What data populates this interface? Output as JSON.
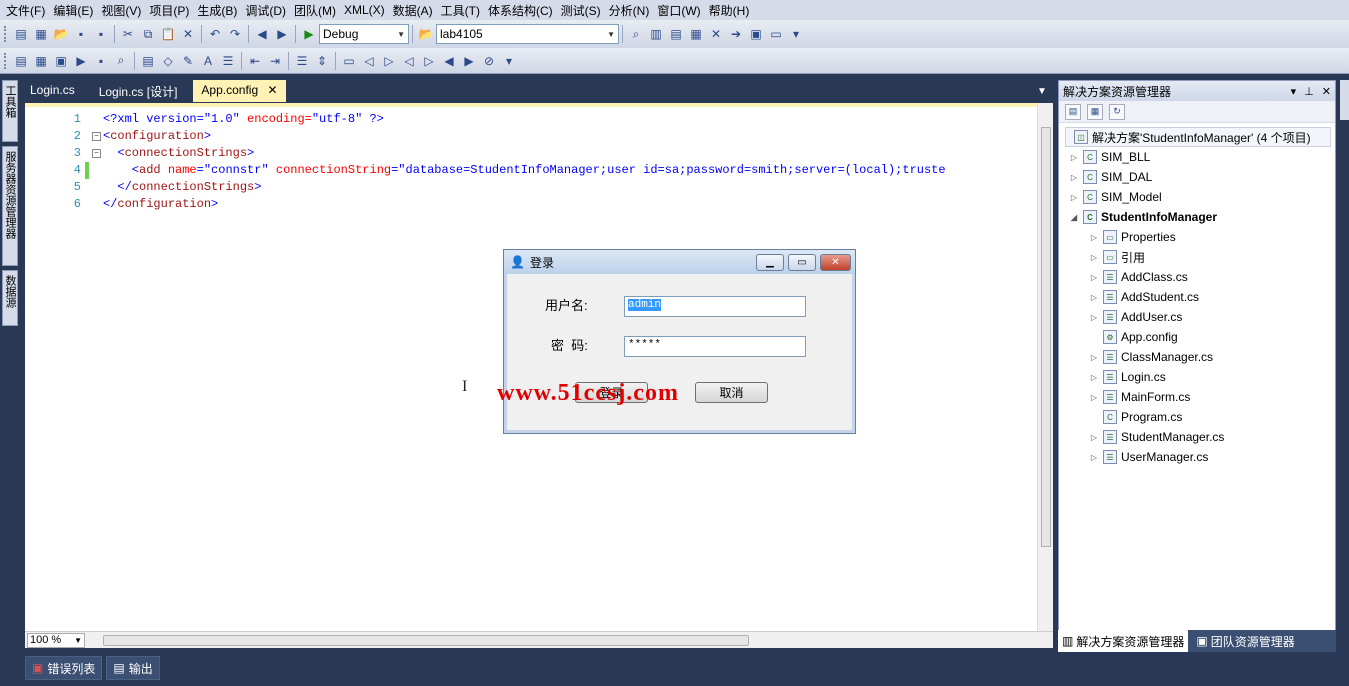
{
  "menu": [
    "文件(F)",
    "编辑(E)",
    "视图(V)",
    "项目(P)",
    "生成(B)",
    "调试(D)",
    "团队(M)",
    "XML(X)",
    "数据(A)",
    "工具(T)",
    "体系结构(C)",
    "测试(S)",
    "分析(N)",
    "窗口(W)",
    "帮助(H)"
  ],
  "toolbar": {
    "config_combo": "Debug",
    "target_combo": "lab4105"
  },
  "left_strip": [
    "工具箱",
    "服务器资源管理器",
    "数据源"
  ],
  "doc_tabs": [
    {
      "label": "Login.cs",
      "active": false
    },
    {
      "label": "Login.cs [设计]",
      "active": false
    },
    {
      "label": "App.config",
      "active": true
    }
  ],
  "code": {
    "line_numbers": [
      "1",
      "2",
      "3",
      "4",
      "5",
      "6"
    ],
    "lines": [
      [
        {
          "t": "<?xml version=",
          "c": "bl"
        },
        {
          "t": "\"1.0\"",
          "c": "bl"
        },
        {
          "t": " encoding=",
          "c": "rd"
        },
        {
          "t": "\"utf-8\"",
          "c": "bl"
        },
        {
          "t": " ?>",
          "c": "bl"
        }
      ],
      [
        {
          "t": "<",
          "c": "bl"
        },
        {
          "t": "configuration",
          "c": "mr"
        },
        {
          "t": ">",
          "c": "bl"
        }
      ],
      [
        {
          "t": "  <",
          "c": "bl"
        },
        {
          "t": "connectionStrings",
          "c": "mr"
        },
        {
          "t": ">",
          "c": "bl"
        }
      ],
      [
        {
          "t": "    <",
          "c": "bl"
        },
        {
          "t": "add",
          "c": "mr"
        },
        {
          "t": " name",
          "c": "rd"
        },
        {
          "t": "=\"",
          "c": "bl"
        },
        {
          "t": "connstr",
          "c": "bl"
        },
        {
          "t": "\"",
          "c": "bl"
        },
        {
          "t": " connectionString",
          "c": "rd"
        },
        {
          "t": "=\"",
          "c": "bl"
        },
        {
          "t": "database=StudentInfoManager;user id=sa;password=smith;server=(local);truste",
          "c": "bl"
        }
      ],
      [
        {
          "t": "  </",
          "c": "bl"
        },
        {
          "t": "connectionStrings",
          "c": "mr"
        },
        {
          "t": ">",
          "c": "bl"
        }
      ],
      [
        {
          "t": "</",
          "c": "bl"
        },
        {
          "t": "configuration",
          "c": "mr"
        },
        {
          "t": ">",
          "c": "bl"
        }
      ]
    ]
  },
  "zoom": "100 %",
  "bottom_tabs": [
    "错误列表",
    "输出"
  ],
  "login_dialog": {
    "title": "登录",
    "username_label": "用户名:",
    "username_value": "admin",
    "password_label": "密  码:",
    "password_value": "*****",
    "login_button": "登录",
    "cancel_button": "取消"
  },
  "watermark": "www.51ccsj.com",
  "solution_explorer": {
    "title": "解决方案资源管理器",
    "tree": [
      {
        "label": "解决方案'StudentInfoManager' (4 个项目)",
        "level": 0,
        "icon": "solution-icon",
        "expander": "",
        "bold": false,
        "root": true
      },
      {
        "label": "SIM_BLL",
        "level": 1,
        "icon": "csharp-project-icon",
        "expander": "▷",
        "bold": false
      },
      {
        "label": "SIM_DAL",
        "level": 1,
        "icon": "csharp-project-icon",
        "expander": "▷",
        "bold": false
      },
      {
        "label": "SIM_Model",
        "level": 1,
        "icon": "csharp-project-icon",
        "expander": "▷",
        "bold": false
      },
      {
        "label": "StudentInfoManager",
        "level": 1,
        "icon": "csharp-project-icon",
        "expander": "◢",
        "bold": true
      },
      {
        "label": "Properties",
        "level": 2,
        "icon": "properties-folder-icon",
        "expander": "▷",
        "bold": false
      },
      {
        "label": "引用",
        "level": 2,
        "icon": "references-icon",
        "expander": "▷",
        "bold": false
      },
      {
        "label": "AddClass.cs",
        "level": 2,
        "icon": "form-file-icon",
        "expander": "▷",
        "bold": false
      },
      {
        "label": "AddStudent.cs",
        "level": 2,
        "icon": "form-file-icon",
        "expander": "▷",
        "bold": false
      },
      {
        "label": "AddUser.cs",
        "level": 2,
        "icon": "form-file-icon",
        "expander": "▷",
        "bold": false
      },
      {
        "label": "App.config",
        "level": 2,
        "icon": "config-file-icon",
        "expander": "",
        "bold": false
      },
      {
        "label": "ClassManager.cs",
        "level": 2,
        "icon": "form-file-icon",
        "expander": "▷",
        "bold": false
      },
      {
        "label": "Login.cs",
        "level": 2,
        "icon": "form-file-icon",
        "expander": "▷",
        "bold": false
      },
      {
        "label": "MainForm.cs",
        "level": 2,
        "icon": "form-file-icon",
        "expander": "▷",
        "bold": false
      },
      {
        "label": "Program.cs",
        "level": 2,
        "icon": "csharp-file-icon",
        "expander": "",
        "bold": false
      },
      {
        "label": "StudentManager.cs",
        "level": 2,
        "icon": "form-file-icon",
        "expander": "▷",
        "bold": false
      },
      {
        "label": "UserManager.cs",
        "level": 2,
        "icon": "form-file-icon",
        "expander": "▷",
        "bold": false
      }
    ],
    "bottom_tabs": [
      "解决方案资源管理器",
      "团队资源管理器"
    ]
  },
  "colors": {
    "ide_background": "#293955",
    "active_tab": "#fff2b4",
    "keyword_blue": "#0000ff",
    "element_maroon": "#a31515",
    "attribute_red": "#ff0000",
    "watermark_red": "#e00000"
  }
}
